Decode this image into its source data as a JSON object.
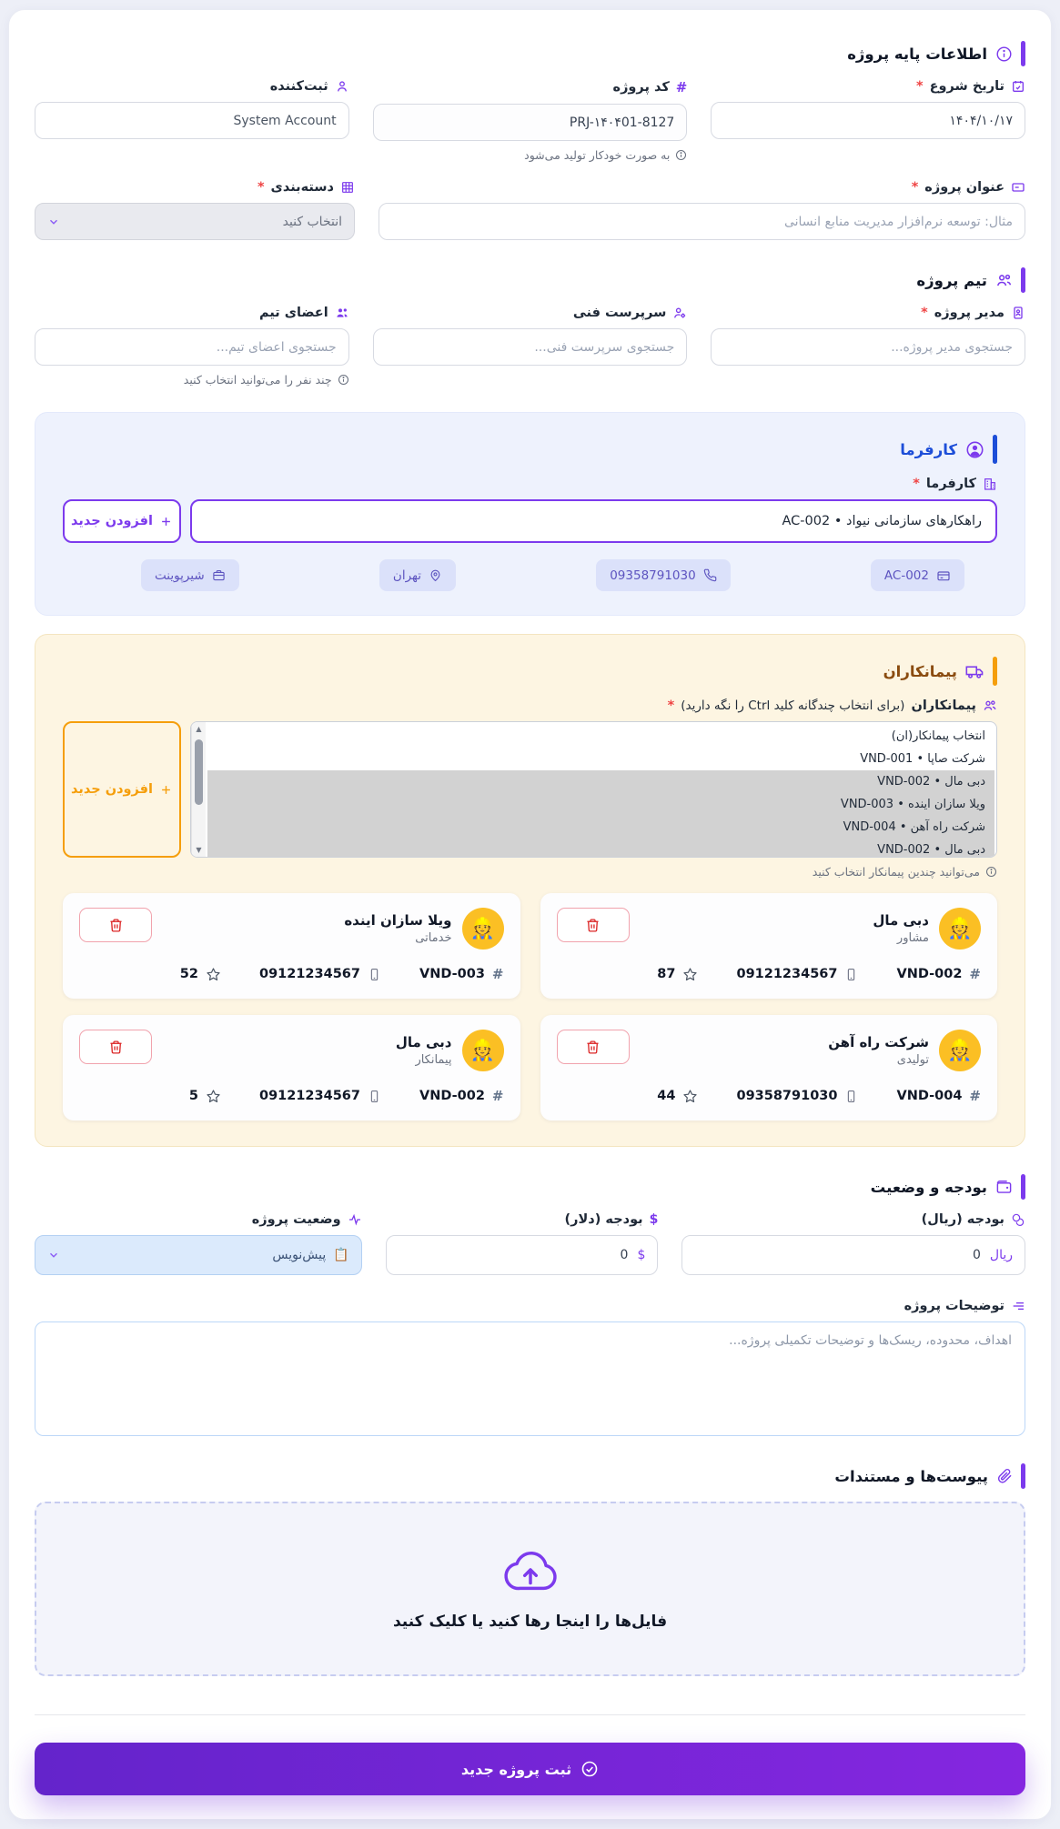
{
  "basic": {
    "title": "اطلاعات پایه پروژه",
    "start_date": {
      "label": "تاریخ شروع",
      "value": "۱۴۰۴/۱۰/۱۷"
    },
    "code": {
      "label": "کد پروژه",
      "value": "PRJ-۱۴۰۴01-8127",
      "hint": "به صورت خودکار تولید می‌شود"
    },
    "registrar": {
      "label": "ثبت‌کننده",
      "value": "System Account"
    },
    "project_title": {
      "label": "عنوان پروژه",
      "placeholder": "مثال: توسعه نرم‌افزار مدیریت منابع انسانی"
    },
    "category": {
      "label": "دسته‌بندی",
      "value": "انتخاب کنید"
    }
  },
  "team": {
    "title": "تیم پروژه",
    "manager": {
      "label": "مدیر پروژه",
      "placeholder": "جستجوی مدیر پروژه..."
    },
    "supervisor": {
      "label": "سرپرست فنی",
      "placeholder": "جستجوی سرپرست فنی..."
    },
    "members": {
      "label": "اعضای تیم",
      "placeholder": "جستجوی اعضای تیم...",
      "hint": "چند نفر را می‌توانید انتخاب کنید"
    }
  },
  "client": {
    "title": "کارفرما",
    "label": "کارفرما",
    "selected": "راهکارهای سازمانی نیواد • AC-002",
    "add_button": "افزودن جدید",
    "chips": [
      {
        "icon": "credit-card-icon",
        "text": "AC-002"
      },
      {
        "icon": "phone-icon",
        "text": "09358791030"
      },
      {
        "icon": "map-pin-icon",
        "text": "تهران"
      },
      {
        "icon": "briefcase-icon",
        "text": "شیرپوینت"
      }
    ]
  },
  "contractors": {
    "title": "پیمانکاران",
    "label_bold": "پیمانکاران",
    "label_rest": "(برای انتخاب چندگانه کلید Ctrl را نگه دارید)",
    "add_button": "افزودن جدید",
    "hint": "می‌توانید چندین پیمانکار انتخاب کنید",
    "avatar_emoji": "👷",
    "options": [
      {
        "text": "انتخاب پیمانکار(ان)",
        "selected": false
      },
      {
        "text": "شرکت صاپا • VND-001",
        "selected": false
      },
      {
        "text": "دبی مال • VND-002",
        "selected": true
      },
      {
        "text": "ویلا سازان اینده • VND-003",
        "selected": true
      },
      {
        "text": "شرکت راه آهن • VND-004",
        "selected": true
      },
      {
        "text": "دبی مال • VND-002",
        "selected": true
      }
    ],
    "cards": [
      {
        "name": "دبی مال",
        "type": "مشاور",
        "code": "VND-002",
        "phone": "09121234567",
        "rating": "87"
      },
      {
        "name": "ویلا سازان اینده",
        "type": "خدماتی",
        "code": "VND-003",
        "phone": "09121234567",
        "rating": "52"
      },
      {
        "name": "شرکت راه آهن",
        "type": "تولیدی",
        "code": "VND-004",
        "phone": "09358791030",
        "rating": "44"
      },
      {
        "name": "دبی مال",
        "type": "پیمانکار",
        "code": "VND-002",
        "phone": "09121234567",
        "rating": "5"
      }
    ]
  },
  "budget": {
    "title": "بودجه و وضعیت",
    "rial": {
      "label": "بودجه (ریال)",
      "unit": "ریال",
      "value": "0"
    },
    "dollar": {
      "label": "بودجه (دلار)",
      "unit": "$",
      "value": "0"
    },
    "status": {
      "label": "وضعیت پروژه",
      "value": "پیش‌نویس",
      "emoji": "📋"
    }
  },
  "description": {
    "label": "توضیحات پروژه",
    "placeholder": "اهداف، محدوده، ریسک‌ها و توضیحات تکمیلی پروژه..."
  },
  "attachments": {
    "title": "پیوست‌ها و مستندات",
    "dropzone_text": "فایل‌ها را اینجا رها کنید یا کلیک کنید"
  },
  "submit": {
    "label": "ثبت پروژه جدید"
  }
}
